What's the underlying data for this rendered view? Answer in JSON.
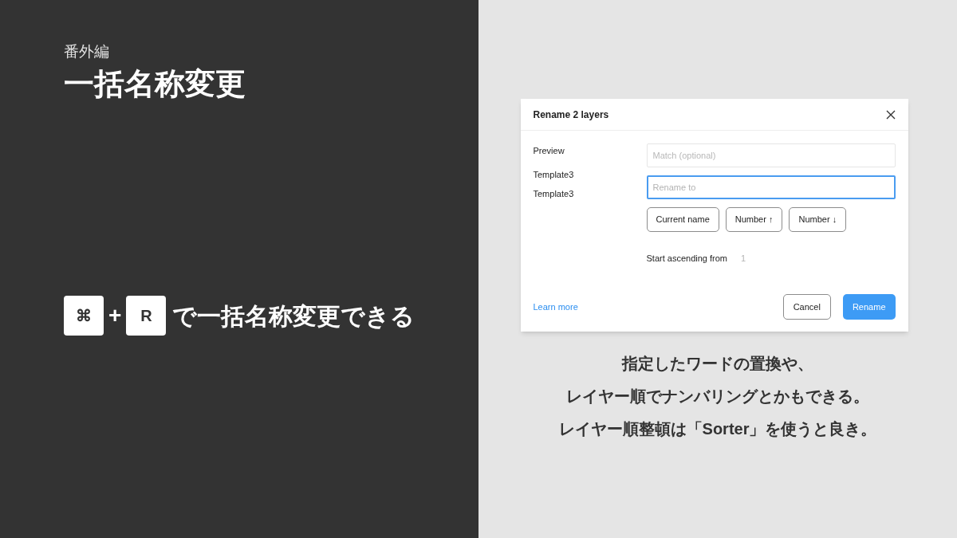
{
  "slide_left": {
    "subtitle": "番外編",
    "title": "一括名称変更",
    "shortcut": {
      "keys": [
        "⌘",
        "R"
      ],
      "plus": "+",
      "text": "で一括名称変更できる"
    }
  },
  "dialog": {
    "title": "Rename 2 layers",
    "preview_label": "Preview",
    "preview_items": [
      "Template3",
      "Template3"
    ],
    "match_field": {
      "placeholder": "Match (optional)",
      "focused": false
    },
    "rename_field": {
      "placeholder": "Rename to",
      "focused": true
    },
    "token_buttons": [
      "Current name",
      "Number ↑",
      "Number ↓"
    ],
    "start_label": "Start ascending from",
    "start_value": "1",
    "learn_more": "Learn more",
    "buttons": [
      {
        "label": "Cancel",
        "kind": "secondary"
      },
      {
        "label": "Rename",
        "kind": "primary"
      }
    ]
  },
  "caption": [
    "指定したワードの置換や、",
    "レイヤー順でナンバリングとかもできる。",
    "レイヤー順整頓は「Sorter」を使うと良き。"
  ]
}
